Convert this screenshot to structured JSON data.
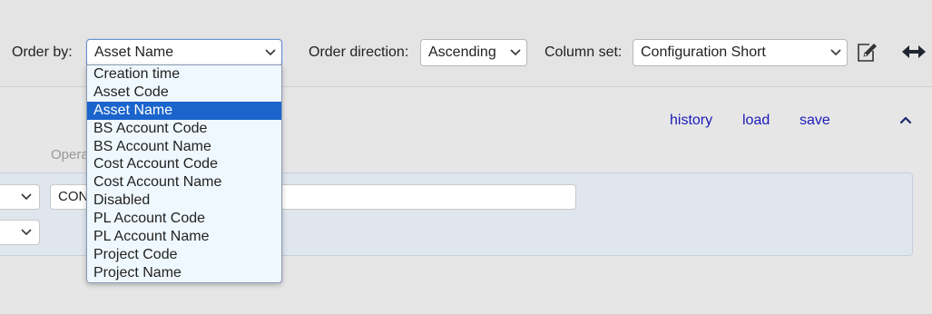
{
  "toolbar": {
    "order_by_label": "Order by:",
    "order_by_value": "Asset Name",
    "order_direction_label": "Order direction:",
    "order_direction_value": "Ascending",
    "column_set_label": "Column set:",
    "column_set_value": "Configuration Short",
    "edit_icon": "pencil-edit-icon",
    "expand_icon": "horizontal-arrows-icon"
  },
  "panel": {
    "history_link": "history",
    "load_link": "load",
    "save_link": "save",
    "collapse_icon": "chevron-up-icon",
    "operator_label": "Operator",
    "condition_value": "CON"
  },
  "dropdown": {
    "options": [
      "Creation time",
      "Asset Code",
      "Asset Name",
      "BS Account Code",
      "BS Account Name",
      "Cost Account Code",
      "Cost Account Name",
      "Disabled",
      "PL Account Code",
      "PL Account Name",
      "Project Code",
      "Project Name"
    ],
    "selected": "Asset Name"
  },
  "colors": {
    "background": "#e4e4e4",
    "link": "#1b1bb8",
    "selection": "#1a64cc",
    "dropdown_bg": "#eff8ff"
  }
}
